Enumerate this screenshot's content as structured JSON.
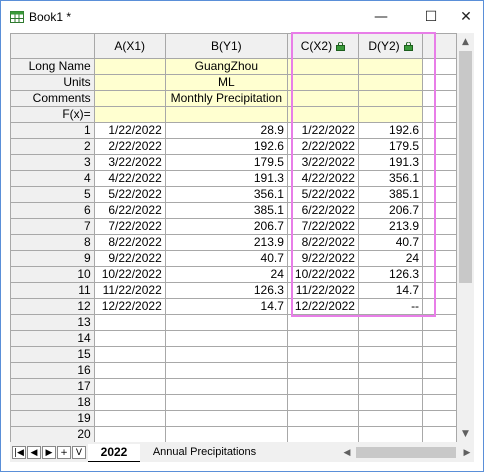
{
  "window": {
    "title": "Book1 *",
    "minimize": "—",
    "maximize": "☐",
    "close": "✕"
  },
  "columns": [
    {
      "label": "A(X1)"
    },
    {
      "label": "B(Y1)"
    },
    {
      "label": "C(X2)"
    },
    {
      "label": "D(Y2)"
    }
  ],
  "meta_rows": [
    {
      "label": "Long Name",
      "cells": [
        "",
        "GuangZhou",
        "",
        ""
      ]
    },
    {
      "label": "Units",
      "cells": [
        "",
        "ML",
        "",
        ""
      ]
    },
    {
      "label": "Comments",
      "cells": [
        "",
        "Monthly Precipitation",
        "",
        ""
      ]
    },
    {
      "label": "F(x)=",
      "cells": [
        "",
        "",
        "",
        ""
      ]
    }
  ],
  "rows": [
    {
      "n": "1",
      "a": "1/22/2022",
      "b": "28.9",
      "c": "1/22/2022",
      "d": "192.6"
    },
    {
      "n": "2",
      "a": "2/22/2022",
      "b": "192.6",
      "c": "2/22/2022",
      "d": "179.5"
    },
    {
      "n": "3",
      "a": "3/22/2022",
      "b": "179.5",
      "c": "3/22/2022",
      "d": "191.3"
    },
    {
      "n": "4",
      "a": "4/22/2022",
      "b": "191.3",
      "c": "4/22/2022",
      "d": "356.1"
    },
    {
      "n": "5",
      "a": "5/22/2022",
      "b": "356.1",
      "c": "5/22/2022",
      "d": "385.1"
    },
    {
      "n": "6",
      "a": "6/22/2022",
      "b": "385.1",
      "c": "6/22/2022",
      "d": "206.7"
    },
    {
      "n": "7",
      "a": "7/22/2022",
      "b": "206.7",
      "c": "7/22/2022",
      "d": "213.9"
    },
    {
      "n": "8",
      "a": "8/22/2022",
      "b": "213.9",
      "c": "8/22/2022",
      "d": "40.7"
    },
    {
      "n": "9",
      "a": "9/22/2022",
      "b": "40.7",
      "c": "9/22/2022",
      "d": "24"
    },
    {
      "n": "10",
      "a": "10/22/2022",
      "b": "24",
      "c": "10/22/2022",
      "d": "126.3"
    },
    {
      "n": "11",
      "a": "11/22/2022",
      "b": "126.3",
      "c": "11/22/2022",
      "d": "14.7"
    },
    {
      "n": "12",
      "a": "12/22/2022",
      "b": "14.7",
      "c": "12/22/2022",
      "d": "--"
    },
    {
      "n": "13",
      "a": "",
      "b": "",
      "c": "",
      "d": ""
    },
    {
      "n": "14",
      "a": "",
      "b": "",
      "c": "",
      "d": ""
    },
    {
      "n": "15",
      "a": "",
      "b": "",
      "c": "",
      "d": ""
    },
    {
      "n": "16",
      "a": "",
      "b": "",
      "c": "",
      "d": ""
    },
    {
      "n": "17",
      "a": "",
      "b": "",
      "c": "",
      "d": ""
    },
    {
      "n": "18",
      "a": "",
      "b": "",
      "c": "",
      "d": ""
    },
    {
      "n": "19",
      "a": "",
      "b": "",
      "c": "",
      "d": ""
    },
    {
      "n": "20",
      "a": "",
      "b": "",
      "c": "",
      "d": ""
    }
  ],
  "nav": {
    "first": "|◀",
    "prev": "◀",
    "next": "▶",
    "add": "+",
    "menu": "V"
  },
  "sheets": {
    "active": "2022",
    "other": "Annual Precipitations"
  },
  "colors": {
    "highlight": "#e87ee8",
    "meta_bg": "#ffffd0",
    "header_bg": "#f0f0f0"
  }
}
